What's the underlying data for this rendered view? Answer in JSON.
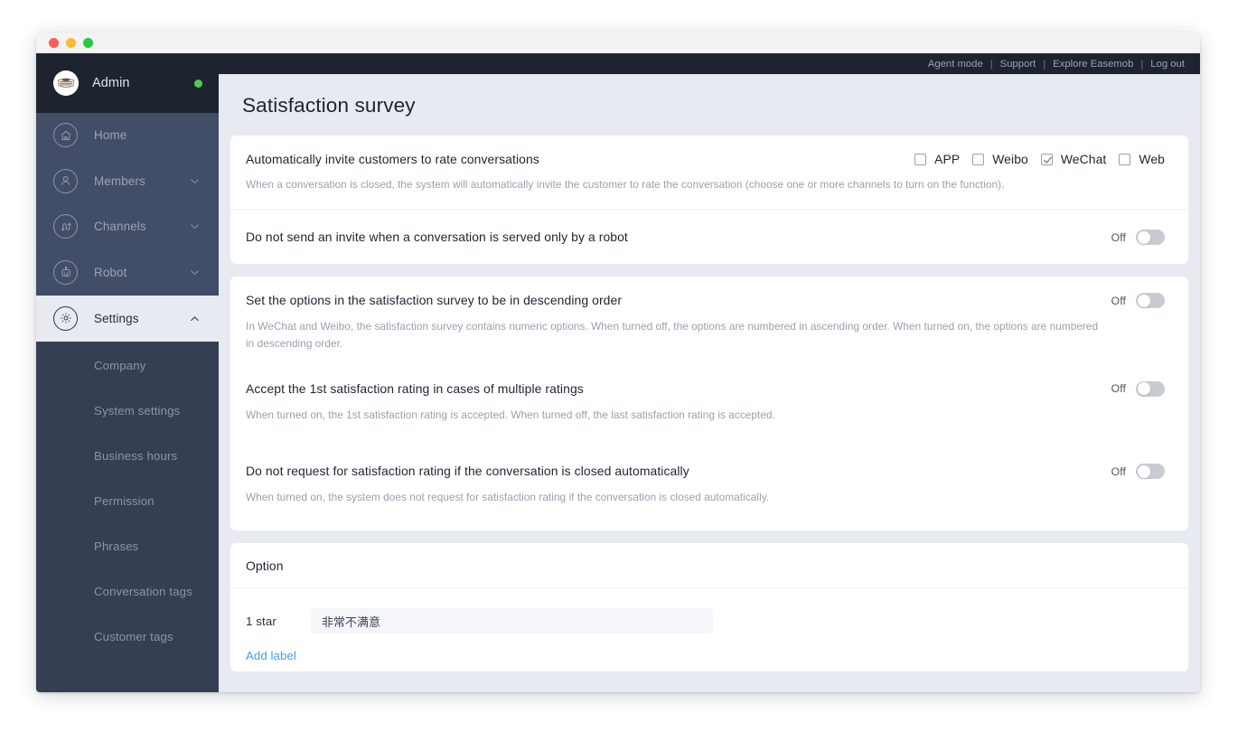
{
  "window": {
    "traffic_lights": [
      "red",
      "yellow",
      "green"
    ]
  },
  "topbar": {
    "links": [
      "Agent mode",
      "Support",
      "Explore Easemob",
      "Log out"
    ],
    "separator": "|"
  },
  "sidebar": {
    "user": {
      "name": "Admin",
      "status": "online",
      "status_color": "#4ccc4c"
    },
    "items": [
      {
        "label": "Home",
        "icon": "home-icon",
        "expandable": false,
        "active": false
      },
      {
        "label": "Members",
        "icon": "members-icon",
        "expandable": true,
        "active": false,
        "chevron": "chevron-down-icon"
      },
      {
        "label": "Channels",
        "icon": "channels-icon",
        "expandable": true,
        "active": false,
        "chevron": "chevron-down-icon"
      },
      {
        "label": "Robot",
        "icon": "robot-icon",
        "expandable": true,
        "active": false,
        "chevron": "chevron-down-icon"
      },
      {
        "label": "Settings",
        "icon": "gear-icon",
        "expandable": true,
        "active": true,
        "chevron": "chevron-up-icon"
      }
    ],
    "subitems": [
      {
        "label": "Company"
      },
      {
        "label": "System settings"
      },
      {
        "label": "Business hours"
      },
      {
        "label": "Permission"
      },
      {
        "label": "Phrases"
      },
      {
        "label": "Conversation tags"
      },
      {
        "label": "Customer tags"
      }
    ]
  },
  "page": {
    "title": "Satisfaction survey"
  },
  "settings": {
    "auto_invite": {
      "title": "Automatically invite customers to rate conversations",
      "desc": "When a conversation is closed, the system will automatically invite the customer to rate the conversation (choose one or more channels to turn on the function).",
      "channels": [
        {
          "label": "APP",
          "checked": false
        },
        {
          "label": "Weibo",
          "checked": false
        },
        {
          "label": "WeChat",
          "checked": true
        },
        {
          "label": "Web",
          "checked": false
        }
      ]
    },
    "robot_only": {
      "title": "Do not send an invite when a conversation is served only by a robot",
      "toggle_label": "Off",
      "toggle_on": false
    },
    "descending_order": {
      "title": "Set the options in the satisfaction survey to be in descending order",
      "desc": "In WeChat and Weibo, the satisfaction survey contains numeric options. When turned off, the options are numbered in ascending order. When turned on, the options are numbered in descending order.",
      "toggle_label": "Off",
      "toggle_on": false
    },
    "first_rating": {
      "title": "Accept the 1st satisfaction rating in cases of multiple ratings",
      "desc": "When turned on, the 1st satisfaction rating is accepted. When turned off, the last satisfaction rating is accepted.",
      "toggle_label": "Off",
      "toggle_on": false
    },
    "auto_closed": {
      "title": "Do not request for satisfaction rating if the conversation is closed automatically",
      "desc": "When turned on, the system does not request for satisfaction rating if the conversation is closed automatically.",
      "toggle_label": "Off",
      "toggle_on": false
    }
  },
  "option_section": {
    "header": "Option",
    "rows": [
      {
        "star": "1 star",
        "value": "非常不满意",
        "placeholder": ""
      }
    ],
    "add_label": "Add label",
    "add_label_color": "#4a9ae8"
  }
}
